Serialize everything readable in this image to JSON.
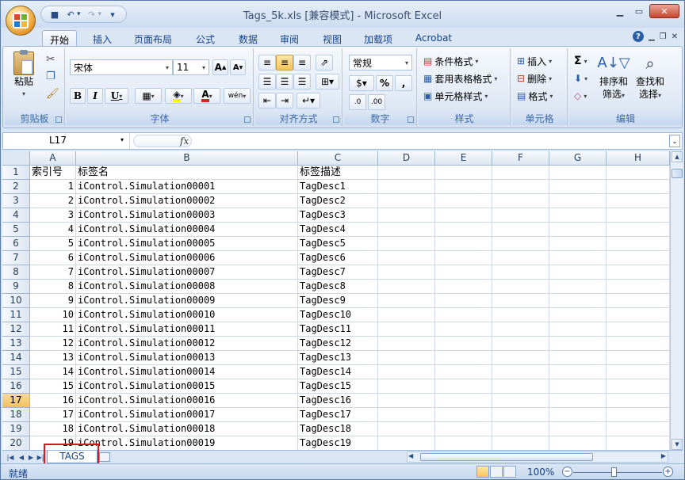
{
  "window": {
    "title": "Tags_5k.xls  [兼容模式] - Microsoft Excel"
  },
  "ribbon_tabs": [
    "开始",
    "插入",
    "页面布局",
    "公式",
    "数据",
    "审阅",
    "视图",
    "加载项",
    "Acrobat"
  ],
  "clipboard": {
    "paste": "粘贴",
    "label": "剪贴板"
  },
  "font": {
    "name": "宋体",
    "size": "11",
    "label": "字体",
    "bold": "B",
    "italic": "I",
    "underline": "U",
    "grow": "A",
    "shrink": "A",
    "wen": "wén"
  },
  "alignment": {
    "label": "对齐方式"
  },
  "number": {
    "format": "常规",
    "label": "数字",
    "percent": "%",
    "comma": ","
  },
  "styles": {
    "conditional": "条件格式",
    "table": "套用表格格式",
    "cell": "单元格样式",
    "label": "样式"
  },
  "cells": {
    "insert": "插入",
    "delete": "删除",
    "format": "格式",
    "label": "单元格"
  },
  "editing": {
    "sigma": "Σ",
    "sort": "排序和",
    "sort2": "筛选",
    "find": "查找和",
    "find2": "选择",
    "label": "编辑"
  },
  "formula_bar": {
    "name_box": "L17",
    "fx": "fx",
    "value": ""
  },
  "columns": [
    "A",
    "B",
    "C",
    "D",
    "E",
    "F",
    "G",
    "H"
  ],
  "rows": [
    {
      "n": "1",
      "a": "索引号",
      "b": "标签名",
      "c": "标签描述"
    },
    {
      "n": "2",
      "a": "1",
      "b": "iControl.Simulation00001",
      "c": "TagDesc1"
    },
    {
      "n": "3",
      "a": "2",
      "b": "iControl.Simulation00002",
      "c": "TagDesc2"
    },
    {
      "n": "4",
      "a": "3",
      "b": "iControl.Simulation00003",
      "c": "TagDesc3"
    },
    {
      "n": "5",
      "a": "4",
      "b": "iControl.Simulation00004",
      "c": "TagDesc4"
    },
    {
      "n": "6",
      "a": "5",
      "b": "iControl.Simulation00005",
      "c": "TagDesc5"
    },
    {
      "n": "7",
      "a": "6",
      "b": "iControl.Simulation00006",
      "c": "TagDesc6"
    },
    {
      "n": "8",
      "a": "7",
      "b": "iControl.Simulation00007",
      "c": "TagDesc7"
    },
    {
      "n": "9",
      "a": "8",
      "b": "iControl.Simulation00008",
      "c": "TagDesc8"
    },
    {
      "n": "10",
      "a": "9",
      "b": "iControl.Simulation00009",
      "c": "TagDesc9"
    },
    {
      "n": "11",
      "a": "10",
      "b": "iControl.Simulation00010",
      "c": "TagDesc10"
    },
    {
      "n": "12",
      "a": "11",
      "b": "iControl.Simulation00011",
      "c": "TagDesc11"
    },
    {
      "n": "13",
      "a": "12",
      "b": "iControl.Simulation00012",
      "c": "TagDesc12"
    },
    {
      "n": "14",
      "a": "13",
      "b": "iControl.Simulation00013",
      "c": "TagDesc13"
    },
    {
      "n": "15",
      "a": "14",
      "b": "iControl.Simulation00014",
      "c": "TagDesc14"
    },
    {
      "n": "16",
      "a": "15",
      "b": "iControl.Simulation00015",
      "c": "TagDesc15"
    },
    {
      "n": "17",
      "a": "16",
      "b": "iControl.Simulation00016",
      "c": "TagDesc16"
    },
    {
      "n": "18",
      "a": "17",
      "b": "iControl.Simulation00017",
      "c": "TagDesc17"
    },
    {
      "n": "19",
      "a": "18",
      "b": "iControl.Simulation00018",
      "c": "TagDesc18"
    },
    {
      "n": "20",
      "a": "19",
      "b": "iControl.Simulation00019",
      "c": "TagDesc19"
    }
  ],
  "selected_row": "17",
  "sheet_tabs": [
    "TAGS"
  ],
  "status": {
    "text": "就绪",
    "zoom": "100%"
  }
}
